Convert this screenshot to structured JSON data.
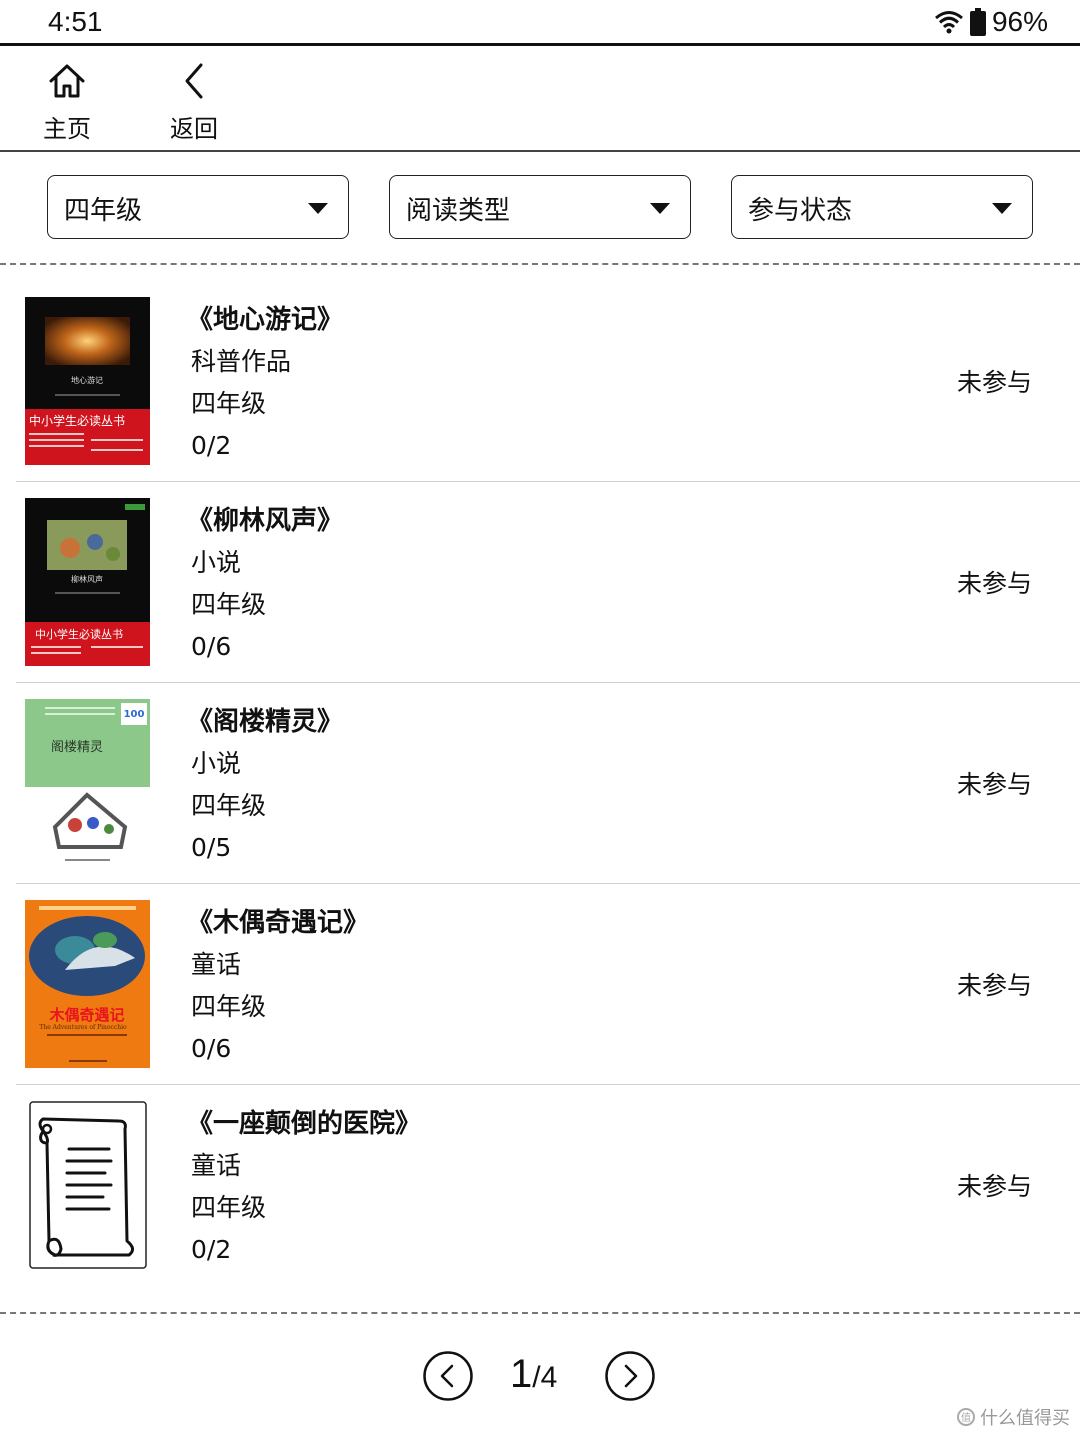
{
  "status_bar": {
    "time": "4:51",
    "battery": "96%"
  },
  "nav": {
    "home_label": "主页",
    "back_label": "返回"
  },
  "filters": [
    {
      "label": "四年级"
    },
    {
      "label": "阅读类型"
    },
    {
      "label": "参与状态"
    }
  ],
  "books": [
    {
      "title": "《地心游记》",
      "genre": "科普作品",
      "grade": "四年级",
      "progress": "0/2",
      "status": "未参与",
      "cover": "black-red-series",
      "cover_title": "地心游记",
      "series": "中小学生必读丛书"
    },
    {
      "title": "《柳林风声》",
      "genre": "小说",
      "grade": "四年级",
      "progress": "0/6",
      "status": "未参与",
      "cover": "black-red-series",
      "cover_title": "柳林风声",
      "series": "中小学生必读丛书"
    },
    {
      "title": "《阁楼精灵》",
      "genre": "小说",
      "grade": "四年级",
      "progress": "0/5",
      "status": "未参与",
      "cover": "green-illustrated",
      "cover_title": "阁楼精灵",
      "badge": "100"
    },
    {
      "title": "《木偶奇遇记》",
      "genre": "童话",
      "grade": "四年级",
      "progress": "0/6",
      "status": "未参与",
      "cover": "orange-illustrated",
      "cover_title": "木偶奇遇记",
      "subtitle": "The Adventures of Pinocchio"
    },
    {
      "title": "《一座颠倒的医院》",
      "genre": "童话",
      "grade": "四年级",
      "progress": "0/2",
      "status": "未参与",
      "cover": "scroll-placeholder-icon"
    }
  ],
  "pager": {
    "current": "1",
    "separator": "/",
    "total": "4"
  },
  "watermark": "什么值得买"
}
